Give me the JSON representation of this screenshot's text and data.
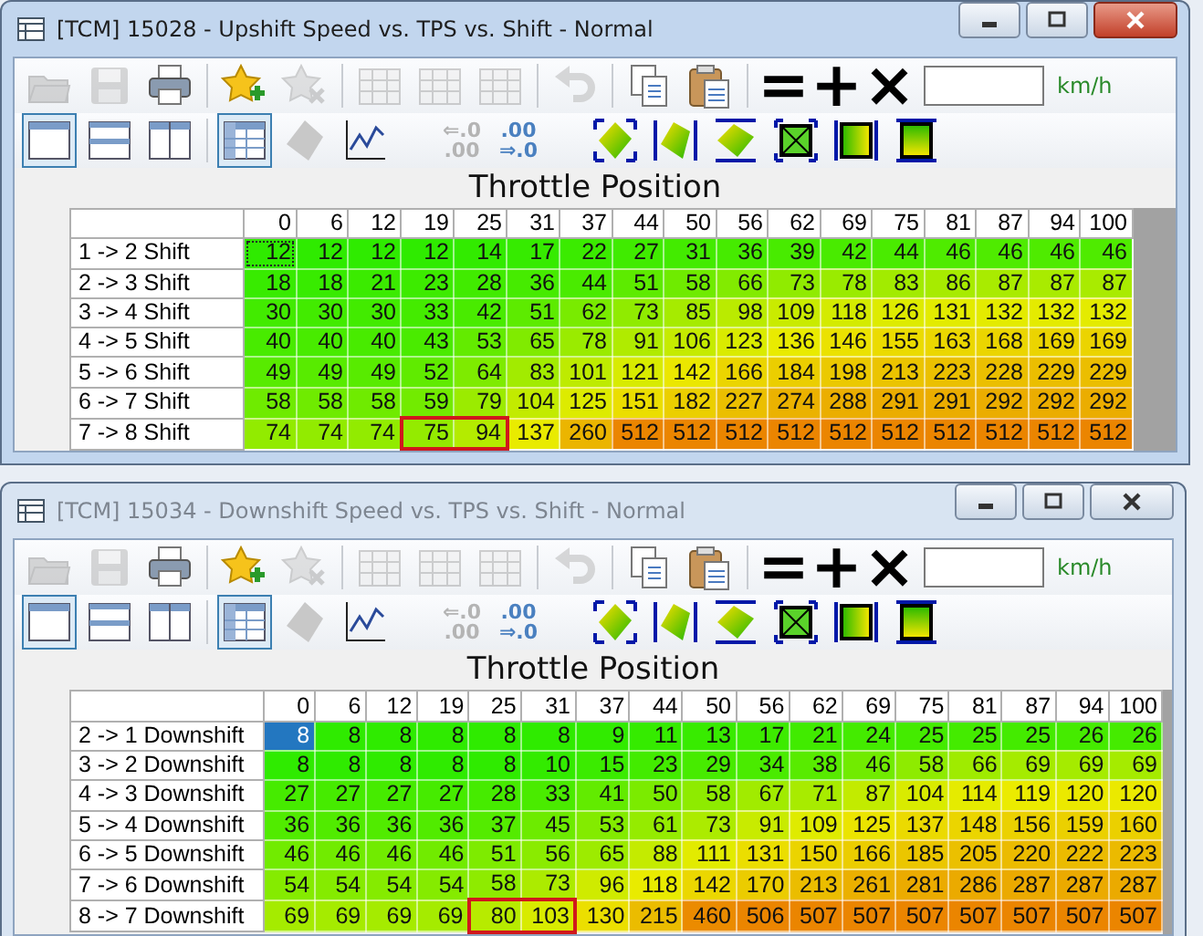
{
  "windows": [
    {
      "title": "[TCM] 15028 - Upshift Speed vs. TPS vs. Shift - Normal",
      "active": true,
      "toolbar": [
        {
          "kind": "open",
          "disabled": true
        },
        {
          "kind": "save",
          "disabled": true
        },
        {
          "kind": "print",
          "disabled": false
        },
        {
          "kind": "separator"
        },
        {
          "kind": "favorite-add",
          "disabled": false
        },
        {
          "kind": "favorite-remove",
          "disabled": true
        },
        {
          "kind": "separator"
        },
        {
          "kind": "grid",
          "disabled": true
        },
        {
          "kind": "grid",
          "disabled": true
        },
        {
          "kind": "grid",
          "disabled": true
        },
        {
          "kind": "separator"
        },
        {
          "kind": "undo",
          "disabled": true
        },
        {
          "kind": "separator"
        },
        {
          "kind": "copy",
          "disabled": false
        },
        {
          "kind": "paste",
          "disabled": false
        },
        {
          "kind": "separator"
        },
        {
          "kind": "set",
          "text": "="
        },
        {
          "kind": "add",
          "text": "+"
        },
        {
          "kind": "multiply",
          "text": "×"
        }
      ],
      "unit": "km/h",
      "view_tools": [
        {
          "kind": "pane-single",
          "selected": true
        },
        {
          "kind": "pane-rows",
          "selected": false
        },
        {
          "kind": "pane-columns",
          "selected": false
        },
        {
          "kind": "separator"
        },
        {
          "kind": "table",
          "selected": true
        },
        {
          "kind": "shape",
          "selected": false
        },
        {
          "kind": "graph",
          "selected": false
        },
        {
          "kind": "gap"
        },
        {
          "kind": "decimals-less",
          "text": "⇐.0\n.00",
          "disabled": true
        },
        {
          "kind": "decimals-more",
          "text": ".00\n⇒.0",
          "disabled": false
        },
        {
          "kind": "gap"
        },
        {
          "kind": "fill-corners"
        },
        {
          "kind": "fill-sides"
        },
        {
          "kind": "fill-ends"
        },
        {
          "kind": "fill-cross"
        },
        {
          "kind": "gradient-across"
        },
        {
          "kind": "gradient-down"
        }
      ],
      "axis_label": "Throttle Position",
      "columns": [
        "0",
        "6",
        "12",
        "19",
        "25",
        "31",
        "37",
        "44",
        "50",
        "56",
        "62",
        "69",
        "75",
        "81",
        "87",
        "94",
        "100"
      ],
      "rows": [
        {
          "label": "1 -> 2 Shift",
          "values": [
            "12",
            "12",
            "12",
            "12",
            "14",
            "17",
            "22",
            "27",
            "31",
            "36",
            "39",
            "42",
            "44",
            "46",
            "46",
            "46",
            "46"
          ],
          "selected": [
            true,
            false,
            false,
            false,
            false,
            false,
            false,
            false,
            false,
            false,
            false,
            false,
            false,
            false,
            false,
            false,
            false
          ],
          "outlined": [
            false,
            false,
            false,
            false,
            false,
            false,
            false,
            false,
            false,
            false,
            false,
            false,
            false,
            false,
            false,
            false,
            false
          ]
        },
        {
          "label": "2 -> 3 Shift",
          "values": [
            "18",
            "18",
            "21",
            "23",
            "28",
            "36",
            "44",
            "51",
            "58",
            "66",
            "73",
            "78",
            "83",
            "86",
            "87",
            "87",
            "87"
          ],
          "selected": [
            false,
            false,
            false,
            false,
            false,
            false,
            false,
            false,
            false,
            false,
            false,
            false,
            false,
            false,
            false,
            false,
            false
          ],
          "outlined": [
            false,
            false,
            false,
            false,
            false,
            false,
            false,
            false,
            false,
            false,
            false,
            false,
            false,
            false,
            false,
            false,
            false
          ]
        },
        {
          "label": "3 -> 4 Shift",
          "values": [
            "30",
            "30",
            "30",
            "33",
            "42",
            "51",
            "62",
            "73",
            "85",
            "98",
            "109",
            "118",
            "126",
            "131",
            "132",
            "132",
            "132"
          ],
          "selected": [
            false,
            false,
            false,
            false,
            false,
            false,
            false,
            false,
            false,
            false,
            false,
            false,
            false,
            false,
            false,
            false,
            false
          ],
          "outlined": [
            false,
            false,
            false,
            false,
            false,
            false,
            false,
            false,
            false,
            false,
            false,
            false,
            false,
            false,
            false,
            false,
            false
          ]
        },
        {
          "label": "4 -> 5 Shift",
          "values": [
            "40",
            "40",
            "40",
            "43",
            "53",
            "65",
            "78",
            "91",
            "106",
            "123",
            "136",
            "146",
            "155",
            "163",
            "168",
            "169",
            "169"
          ],
          "selected": [
            false,
            false,
            false,
            false,
            false,
            false,
            false,
            false,
            false,
            false,
            false,
            false,
            false,
            false,
            false,
            false,
            false
          ],
          "outlined": [
            false,
            false,
            false,
            false,
            false,
            false,
            false,
            false,
            false,
            false,
            false,
            false,
            false,
            false,
            false,
            false,
            false
          ]
        },
        {
          "label": "5 -> 6 Shift",
          "values": [
            "49",
            "49",
            "49",
            "52",
            "64",
            "83",
            "101",
            "121",
            "142",
            "166",
            "184",
            "198",
            "213",
            "223",
            "228",
            "229",
            "229"
          ],
          "selected": [
            false,
            false,
            false,
            false,
            false,
            false,
            false,
            false,
            false,
            false,
            false,
            false,
            false,
            false,
            false,
            false,
            false
          ],
          "outlined": [
            false,
            false,
            false,
            false,
            false,
            false,
            false,
            false,
            false,
            false,
            false,
            false,
            false,
            false,
            false,
            false,
            false
          ]
        },
        {
          "label": "6 -> 7 Shift",
          "values": [
            "58",
            "58",
            "58",
            "59",
            "79",
            "104",
            "125",
            "151",
            "182",
            "227",
            "274",
            "288",
            "291",
            "291",
            "292",
            "292",
            "292"
          ],
          "selected": [
            false,
            false,
            false,
            false,
            false,
            false,
            false,
            false,
            false,
            false,
            false,
            false,
            false,
            false,
            false,
            false,
            false
          ],
          "outlined": [
            false,
            false,
            false,
            false,
            false,
            false,
            false,
            false,
            false,
            false,
            false,
            false,
            false,
            false,
            false,
            false,
            false
          ]
        },
        {
          "label": "7 -> 8 Shift",
          "values": [
            "74",
            "74",
            "74",
            "75",
            "94",
            "137",
            "260",
            "512",
            "512",
            "512",
            "512",
            "512",
            "512",
            "512",
            "512",
            "512",
            "512"
          ],
          "selected": [
            false,
            false,
            false,
            false,
            false,
            false,
            false,
            false,
            false,
            false,
            false,
            false,
            false,
            false,
            false,
            false,
            false
          ],
          "outlined": [
            false,
            false,
            false,
            true,
            true,
            false,
            false,
            false,
            false,
            false,
            false,
            false,
            false,
            false,
            false,
            false,
            false
          ]
        }
      ]
    },
    {
      "title": "[TCM] 15034 - Downshift Speed vs. TPS vs. Shift - Normal",
      "active": false,
      "toolbar": [
        {
          "kind": "open",
          "disabled": true
        },
        {
          "kind": "save",
          "disabled": true
        },
        {
          "kind": "print",
          "disabled": false
        },
        {
          "kind": "separator"
        },
        {
          "kind": "favorite-add",
          "disabled": false
        },
        {
          "kind": "favorite-remove",
          "disabled": true
        },
        {
          "kind": "separator"
        },
        {
          "kind": "grid",
          "disabled": true
        },
        {
          "kind": "grid",
          "disabled": true
        },
        {
          "kind": "grid",
          "disabled": true
        },
        {
          "kind": "separator"
        },
        {
          "kind": "undo",
          "disabled": true
        },
        {
          "kind": "separator"
        },
        {
          "kind": "copy",
          "disabled": false
        },
        {
          "kind": "paste",
          "disabled": false
        },
        {
          "kind": "separator"
        },
        {
          "kind": "set",
          "text": "="
        },
        {
          "kind": "add",
          "text": "+"
        },
        {
          "kind": "multiply",
          "text": "×"
        }
      ],
      "unit": "km/h",
      "view_tools": [
        {
          "kind": "pane-single",
          "selected": true
        },
        {
          "kind": "pane-rows",
          "selected": false
        },
        {
          "kind": "pane-columns",
          "selected": false
        },
        {
          "kind": "separator"
        },
        {
          "kind": "table",
          "selected": true
        },
        {
          "kind": "shape",
          "selected": false
        },
        {
          "kind": "graph",
          "selected": false
        },
        {
          "kind": "gap"
        },
        {
          "kind": "decimals-less",
          "text": "⇐.0\n.00",
          "disabled": true
        },
        {
          "kind": "decimals-more",
          "text": ".00\n⇒.0",
          "disabled": false
        },
        {
          "kind": "gap"
        },
        {
          "kind": "fill-corners"
        },
        {
          "kind": "fill-sides"
        },
        {
          "kind": "fill-ends"
        },
        {
          "kind": "fill-cross"
        },
        {
          "kind": "gradient-across"
        },
        {
          "kind": "gradient-down"
        }
      ],
      "axis_label": "Throttle Position",
      "columns": [
        "0",
        "6",
        "12",
        "19",
        "25",
        "31",
        "37",
        "44",
        "50",
        "56",
        "62",
        "69",
        "75",
        "81",
        "87",
        "94",
        "100"
      ],
      "rows": [
        {
          "label": "2 -> 1 Downshift",
          "values": [
            "8",
            "8",
            "8",
            "8",
            "8",
            "8",
            "9",
            "11",
            "13",
            "17",
            "21",
            "24",
            "25",
            "25",
            "25",
            "26",
            "26"
          ],
          "selected": [
            true,
            false,
            false,
            false,
            false,
            false,
            false,
            false,
            false,
            false,
            false,
            false,
            false,
            false,
            false,
            false,
            false
          ],
          "outlined": [
            false,
            false,
            false,
            false,
            false,
            false,
            false,
            false,
            false,
            false,
            false,
            false,
            false,
            false,
            false,
            false,
            false
          ]
        },
        {
          "label": "3 -> 2 Downshift",
          "values": [
            "8",
            "8",
            "8",
            "8",
            "8",
            "10",
            "15",
            "23",
            "29",
            "34",
            "38",
            "46",
            "58",
            "66",
            "69",
            "69",
            "69"
          ],
          "selected": [
            false,
            false,
            false,
            false,
            false,
            false,
            false,
            false,
            false,
            false,
            false,
            false,
            false,
            false,
            false,
            false,
            false
          ],
          "outlined": [
            false,
            false,
            false,
            false,
            false,
            false,
            false,
            false,
            false,
            false,
            false,
            false,
            false,
            false,
            false,
            false,
            false
          ]
        },
        {
          "label": "4 -> 3 Downshift",
          "values": [
            "27",
            "27",
            "27",
            "27",
            "28",
            "33",
            "41",
            "50",
            "58",
            "67",
            "71",
            "87",
            "104",
            "114",
            "119",
            "120",
            "120"
          ],
          "selected": [
            false,
            false,
            false,
            false,
            false,
            false,
            false,
            false,
            false,
            false,
            false,
            false,
            false,
            false,
            false,
            false,
            false
          ],
          "outlined": [
            false,
            false,
            false,
            false,
            false,
            false,
            false,
            false,
            false,
            false,
            false,
            false,
            false,
            false,
            false,
            false,
            false
          ]
        },
        {
          "label": "5 -> 4 Downshift",
          "values": [
            "36",
            "36",
            "36",
            "36",
            "37",
            "45",
            "53",
            "61",
            "73",
            "91",
            "109",
            "125",
            "137",
            "148",
            "156",
            "159",
            "160"
          ],
          "selected": [
            false,
            false,
            false,
            false,
            false,
            false,
            false,
            false,
            false,
            false,
            false,
            false,
            false,
            false,
            false,
            false,
            false
          ],
          "outlined": [
            false,
            false,
            false,
            false,
            false,
            false,
            false,
            false,
            false,
            false,
            false,
            false,
            false,
            false,
            false,
            false,
            false
          ]
        },
        {
          "label": "6 -> 5 Downshift",
          "values": [
            "46",
            "46",
            "46",
            "46",
            "51",
            "56",
            "65",
            "88",
            "111",
            "131",
            "150",
            "166",
            "185",
            "205",
            "220",
            "222",
            "223"
          ],
          "selected": [
            false,
            false,
            false,
            false,
            false,
            false,
            false,
            false,
            false,
            false,
            false,
            false,
            false,
            false,
            false,
            false,
            false
          ],
          "outlined": [
            false,
            false,
            false,
            false,
            false,
            false,
            false,
            false,
            false,
            false,
            false,
            false,
            false,
            false,
            false,
            false,
            false
          ]
        },
        {
          "label": "7 -> 6 Downshift",
          "values": [
            "54",
            "54",
            "54",
            "54",
            "58",
            "73",
            "96",
            "118",
            "142",
            "170",
            "213",
            "261",
            "281",
            "286",
            "287",
            "287",
            "287"
          ],
          "selected": [
            false,
            false,
            false,
            false,
            false,
            false,
            false,
            false,
            false,
            false,
            false,
            false,
            false,
            false,
            false,
            false,
            false
          ],
          "outlined": [
            false,
            false,
            false,
            false,
            false,
            false,
            false,
            false,
            false,
            false,
            false,
            false,
            false,
            false,
            false,
            false,
            false
          ]
        },
        {
          "label": "8 -> 7 Downshift",
          "values": [
            "69",
            "69",
            "69",
            "69",
            "80",
            "103",
            "130",
            "215",
            "460",
            "506",
            "507",
            "507",
            "507",
            "507",
            "507",
            "507",
            "507"
          ],
          "selected": [
            false,
            false,
            false,
            false,
            false,
            false,
            false,
            false,
            false,
            false,
            false,
            false,
            false,
            false,
            false,
            false,
            false
          ],
          "outlined": [
            false,
            false,
            false,
            false,
            true,
            true,
            false,
            false,
            false,
            false,
            false,
            false,
            false,
            false,
            false,
            false,
            false
          ]
        }
      ]
    }
  ]
}
